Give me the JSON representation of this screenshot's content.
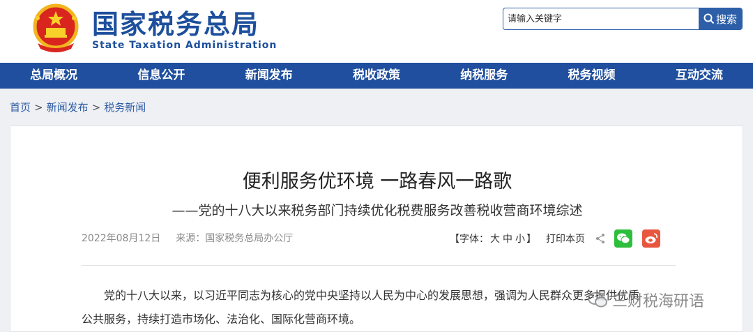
{
  "header": {
    "brand_cn": "国家税务总局",
    "brand_en": "State Taxation Administration",
    "search_placeholder": "请输入关键字",
    "search_button": "搜索"
  },
  "nav": {
    "items": [
      "总局概况",
      "信息公开",
      "新闻发布",
      "税收政策",
      "纳税服务",
      "税务视频",
      "互动交流"
    ]
  },
  "breadcrumb": [
    "首页",
    "新闻发布",
    "税务新闻"
  ],
  "article": {
    "title": "便利服务优环境 一路春风一路歌",
    "subtitle": "——党的十八大以来税务部门持续优化税费服务改善税收营商环境综述",
    "date": "2022年08月12日",
    "source": "来源：国家税务总局办公厅",
    "font_label_open": "【字体：",
    "font_sizes": [
      "大",
      "中",
      "小"
    ],
    "font_label_close": "】",
    "print": "打印本页",
    "paragraph_1": "党的十八大以来，以习近平同志为核心的党中央坚持以人民为中心的发展思想，强调为人民群众更多提供优质",
    "paragraph_2": "公共服务，持续打造市场化、法治化、国际化营商环境。"
  },
  "watermark": {
    "text": "三财税海研语"
  },
  "colors": {
    "brand_blue": "#1d4f9c",
    "nav_blue": "#1f4f9e",
    "wechat_green": "#2dbe3c",
    "weibo_red": "#e8563f"
  }
}
